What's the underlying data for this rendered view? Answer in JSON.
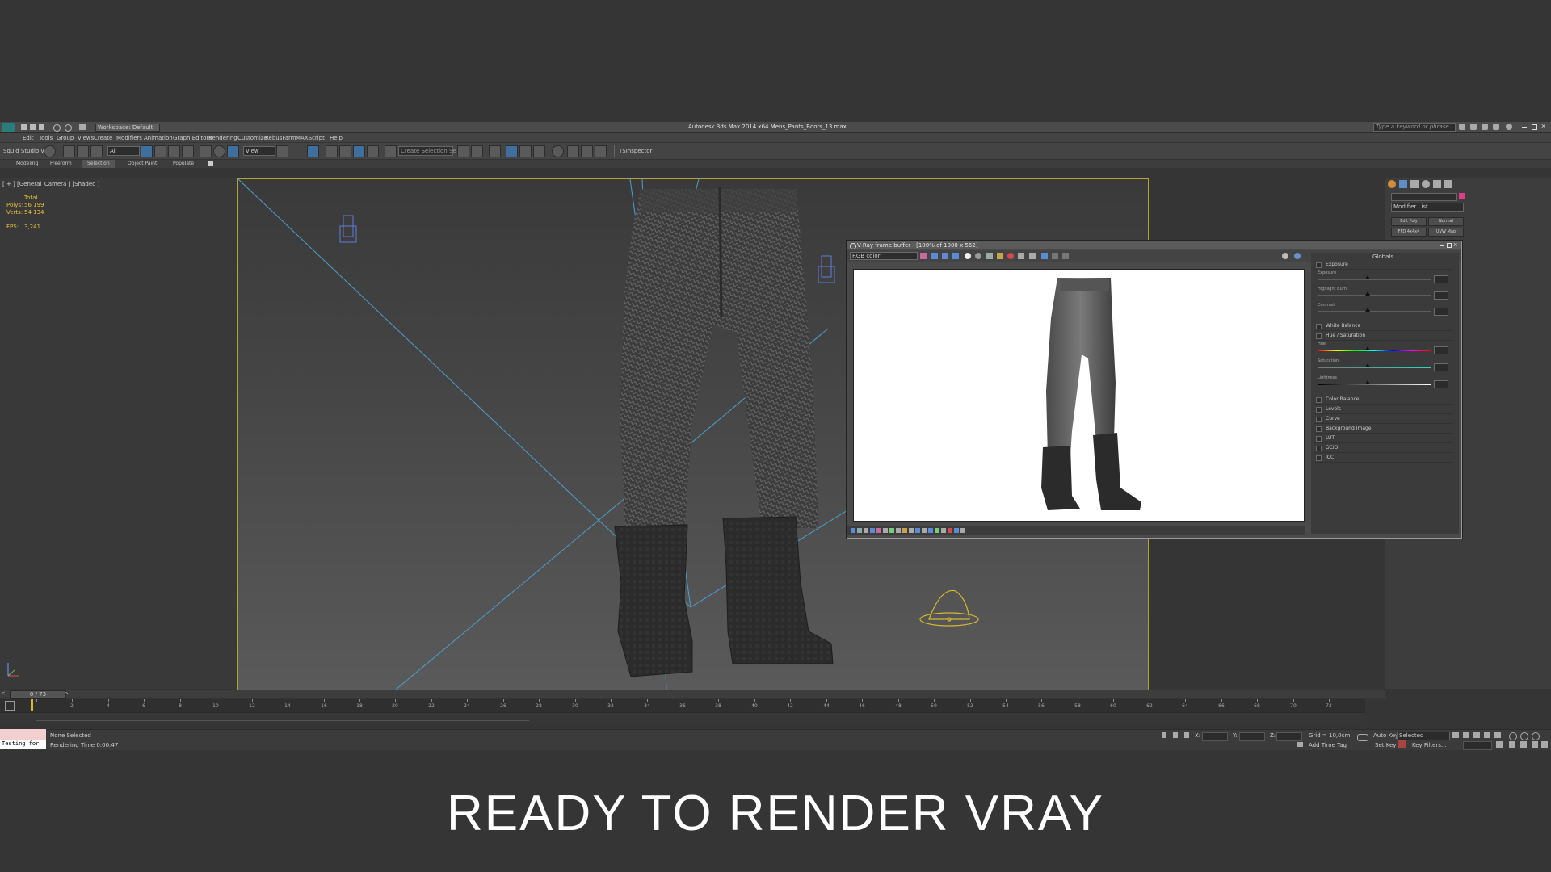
{
  "window": {
    "title": "Autodesk 3ds Max  2014 x64      Mens_Pants_Boots_13.max",
    "workspace": "Workspace: Default",
    "search_placeholder": "Type a keyword or phrase"
  },
  "menu": {
    "items": [
      "Edit",
      "Tools",
      "Group",
      "Views",
      "Create",
      "Modifiers",
      "Animation",
      "Graph Editors",
      "Rendering",
      "Customize",
      "RebusFarm",
      "MAXScript",
      "Help"
    ]
  },
  "toolbar": {
    "left_label": "Squid Studio v",
    "filter_value": "All",
    "view_value": "View",
    "selection_set_placeholder": "Create Selection Se",
    "ts_label": "TSInspector"
  },
  "ribbon": {
    "tabs": [
      "Modeling",
      "Freeform",
      "Selection",
      "Object Paint",
      "Populate"
    ],
    "active": "Selection"
  },
  "viewport": {
    "label": "[ + ] [General_Camera ] [Shaded ]",
    "stats": {
      "total_label": "Total",
      "polys_label": "Polys:",
      "polys_value": "56 199",
      "verts_label": "Verts:",
      "verts_value": "54 134",
      "fps_label": "FPS:",
      "fps_value": "3,241"
    }
  },
  "command_panel": {
    "modifier_list": "Modifier List",
    "buttons": [
      "Edit Poly",
      "Normal",
      "FFD 4x4x4",
      "UVW Map"
    ]
  },
  "vfb": {
    "title": "V-Ray frame buffer - [100% of 1000 x 562]",
    "channel": "RGB color",
    "globals": "Globals...",
    "corrections": [
      {
        "label": "Exposure",
        "expanded": true
      },
      {
        "label": "White Balance",
        "expanded": false
      },
      {
        "label": "Hue / Saturation",
        "expanded": true
      },
      {
        "label": "Color Balance",
        "expanded": false
      },
      {
        "label": "Levels",
        "expanded": false
      },
      {
        "label": "Curve",
        "expanded": false
      },
      {
        "label": "Background Image",
        "expanded": false
      },
      {
        "label": "LUT",
        "expanded": false
      },
      {
        "label": "OCIO",
        "expanded": false
      },
      {
        "label": "ICC",
        "expanded": false
      }
    ],
    "exposure_sliders": [
      "Exposure",
      "Highlight Burn",
      "Contrast"
    ],
    "hue_sliders": [
      "Hue",
      "Saturation",
      "Lightness"
    ]
  },
  "timeline": {
    "frame_display": "0 / 73",
    "ticks": [
      "0",
      "2",
      "4",
      "6",
      "8",
      "10",
      "12",
      "14",
      "16",
      "18",
      "20",
      "22",
      "24",
      "26",
      "28",
      "30",
      "32",
      "34",
      "36",
      "38",
      "40",
      "42",
      "44",
      "46",
      "48",
      "50",
      "52",
      "54",
      "56",
      "58",
      "60",
      "62",
      "64",
      "66",
      "68",
      "70",
      "72"
    ]
  },
  "status": {
    "maxscript_text": "Testing for",
    "selection": "None Selected",
    "render_time": "Rendering Time  0:00:47",
    "x_label": "X:",
    "y_label": "Y:",
    "z_label": "Z:",
    "grid": "Grid = 10,0cm",
    "add_time_tag": "Add Time Tag",
    "auto_key": "Auto Key",
    "selected": "Selected",
    "set_key": "Set Key",
    "key_filters": "Key Filters..."
  },
  "caption": "READY TO RENDER VRAY",
  "colors": {
    "viewport_border": "#b6a03a",
    "light_lines": "#4b9fd0",
    "helper_yellow": "#d6b930",
    "stat_yellow": "#e8c23a"
  }
}
